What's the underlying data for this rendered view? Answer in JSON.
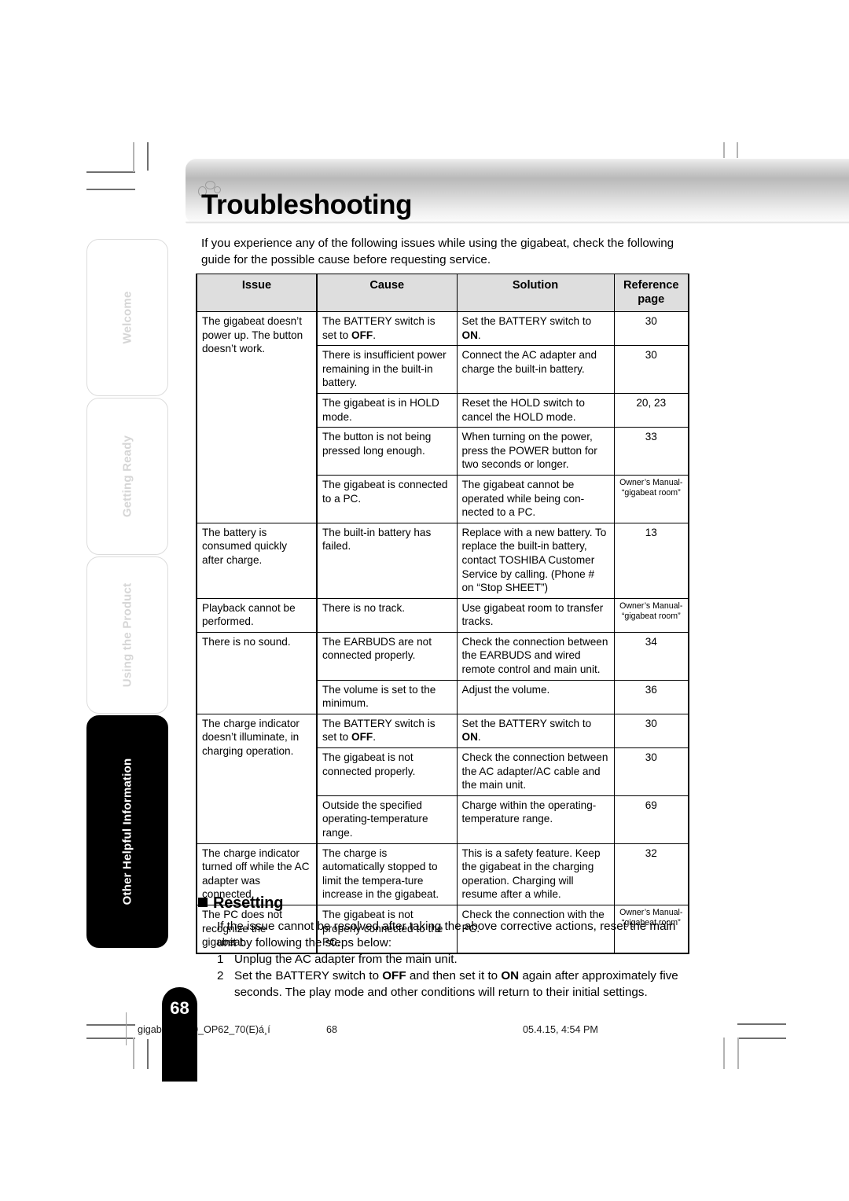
{
  "header": {
    "title": "Troubleshooting",
    "bubbles_icon": "bubbles-icon"
  },
  "intro": "If you experience any of the following issues while using the gigabeat, check the following guide for the possible cause before requesting service.",
  "sidebar": {
    "items": [
      {
        "label": "Welcome",
        "active": false
      },
      {
        "label": "Getting Ready",
        "active": false
      },
      {
        "label": "Using the Product",
        "active": false
      },
      {
        "label": "Other Helpful Information",
        "active": true
      }
    ]
  },
  "table": {
    "headers": {
      "issue": "Issue",
      "cause": "Cause",
      "solution": "Solution",
      "reference": "Reference page"
    },
    "rows": [
      {
        "issue": "The gigabeat doesn’t power up. The button doesn’t work.",
        "cause": "The BATTERY switch is set to OFF.",
        "cause_bold": "OFF",
        "solution": "Set the BATTERY switch to ON.",
        "solution_bold": "ON",
        "reference": "30",
        "reference_small": false
      },
      {
        "cause": "There is insufficient power remaining in the built-in battery.",
        "solution": "Connect the AC adapter and charge the built-in battery.",
        "reference": "30",
        "reference_small": false
      },
      {
        "cause": "The gigabeat is in HOLD mode.",
        "solution": "Reset the HOLD switch to cancel the HOLD mode.",
        "reference": "20, 23",
        "reference_small": false
      },
      {
        "cause": "The button is not being pressed long enough.",
        "solution": "When turning on the power, press the POWER button for two seconds or longer.",
        "reference": "33",
        "reference_small": false
      },
      {
        "cause": "The gigabeat is connected to a PC.",
        "solution": "The gigabeat cannot be operated while being con-nected to a PC.",
        "reference": "Owner’s Manual- “gigabeat room”",
        "reference_small": true
      },
      {
        "issue": "The battery is consumed quickly after charge.",
        "cause": "The built-in battery has failed.",
        "solution": "Replace with a new battery. To replace the built-in battery, contact TOSHIBA Customer Service by calling. (Phone # on “Stop SHEET”)",
        "reference": "13",
        "reference_small": false
      },
      {
        "issue": "Playback cannot be performed.",
        "cause": "There is no track.",
        "solution": "Use gigabeat room to transfer tracks.",
        "reference": "Owner’s Manual- “gigabeat room”",
        "reference_small": true
      },
      {
        "issue": "There is no sound.",
        "cause": "The EARBUDS are not connected properly.",
        "solution": "Check the connection between the EARBUDS and wired remote control and main unit.",
        "reference": "34",
        "reference_small": false
      },
      {
        "cause": "The volume is set to the minimum.",
        "solution": "Adjust the volume.",
        "reference": "36",
        "reference_small": false
      },
      {
        "issue": "The charge indicator doesn’t illuminate, in charging operation.",
        "cause": "The BATTERY switch is set to OFF.",
        "cause_bold": "OFF",
        "solution": "Set the BATTERY switch to ON.",
        "solution_bold": "ON",
        "reference": "30",
        "reference_small": false
      },
      {
        "cause": "The gigabeat is not connected properly.",
        "solution": "Check the connection between the AC adapter/AC cable and the main unit.",
        "reference": "30",
        "reference_small": false
      },
      {
        "cause": "Outside the specified operating-temperature range.",
        "solution": "Charge within the operating-temperature range.",
        "reference": "69",
        "reference_small": false
      },
      {
        "issue": "The charge indicator turned off while the AC adapter was connected.",
        "cause": "The charge is automatically stopped to limit the tempera-ture increase in the gigabeat.",
        "solution": "This is a safety feature. Keep the gigabeat in the charging operation. Charging will resume after a while.",
        "reference": "32",
        "reference_small": false
      },
      {
        "issue": "The PC does not recognize the gigabeat.",
        "cause": "The gigabeat is not properly connected to the PC.",
        "solution": "Check the connection with the PC.",
        "reference": "Owner’s Manual- “gigabeat room”",
        "reference_small": true
      }
    ]
  },
  "resetting": {
    "heading": "Resetting",
    "intro": "If the issue cannot be resolved after taking the above corrective actions, reset the main unit by following the steps below:",
    "steps": [
      {
        "num": "1",
        "text": "Unplug the AC adapter from the main unit."
      },
      {
        "num": "2",
        "text": "Set the BATTERY switch to OFF and then set it to ON again after approximately five seconds. The play mode and other conditions will return to their initial settings."
      }
    ]
  },
  "footer": {
    "page_number": "68",
    "filename": "gigabeat_F60_OP62_70(E)á¸í",
    "page_label": "68",
    "date": "05.4.15, 4:54 PM"
  }
}
